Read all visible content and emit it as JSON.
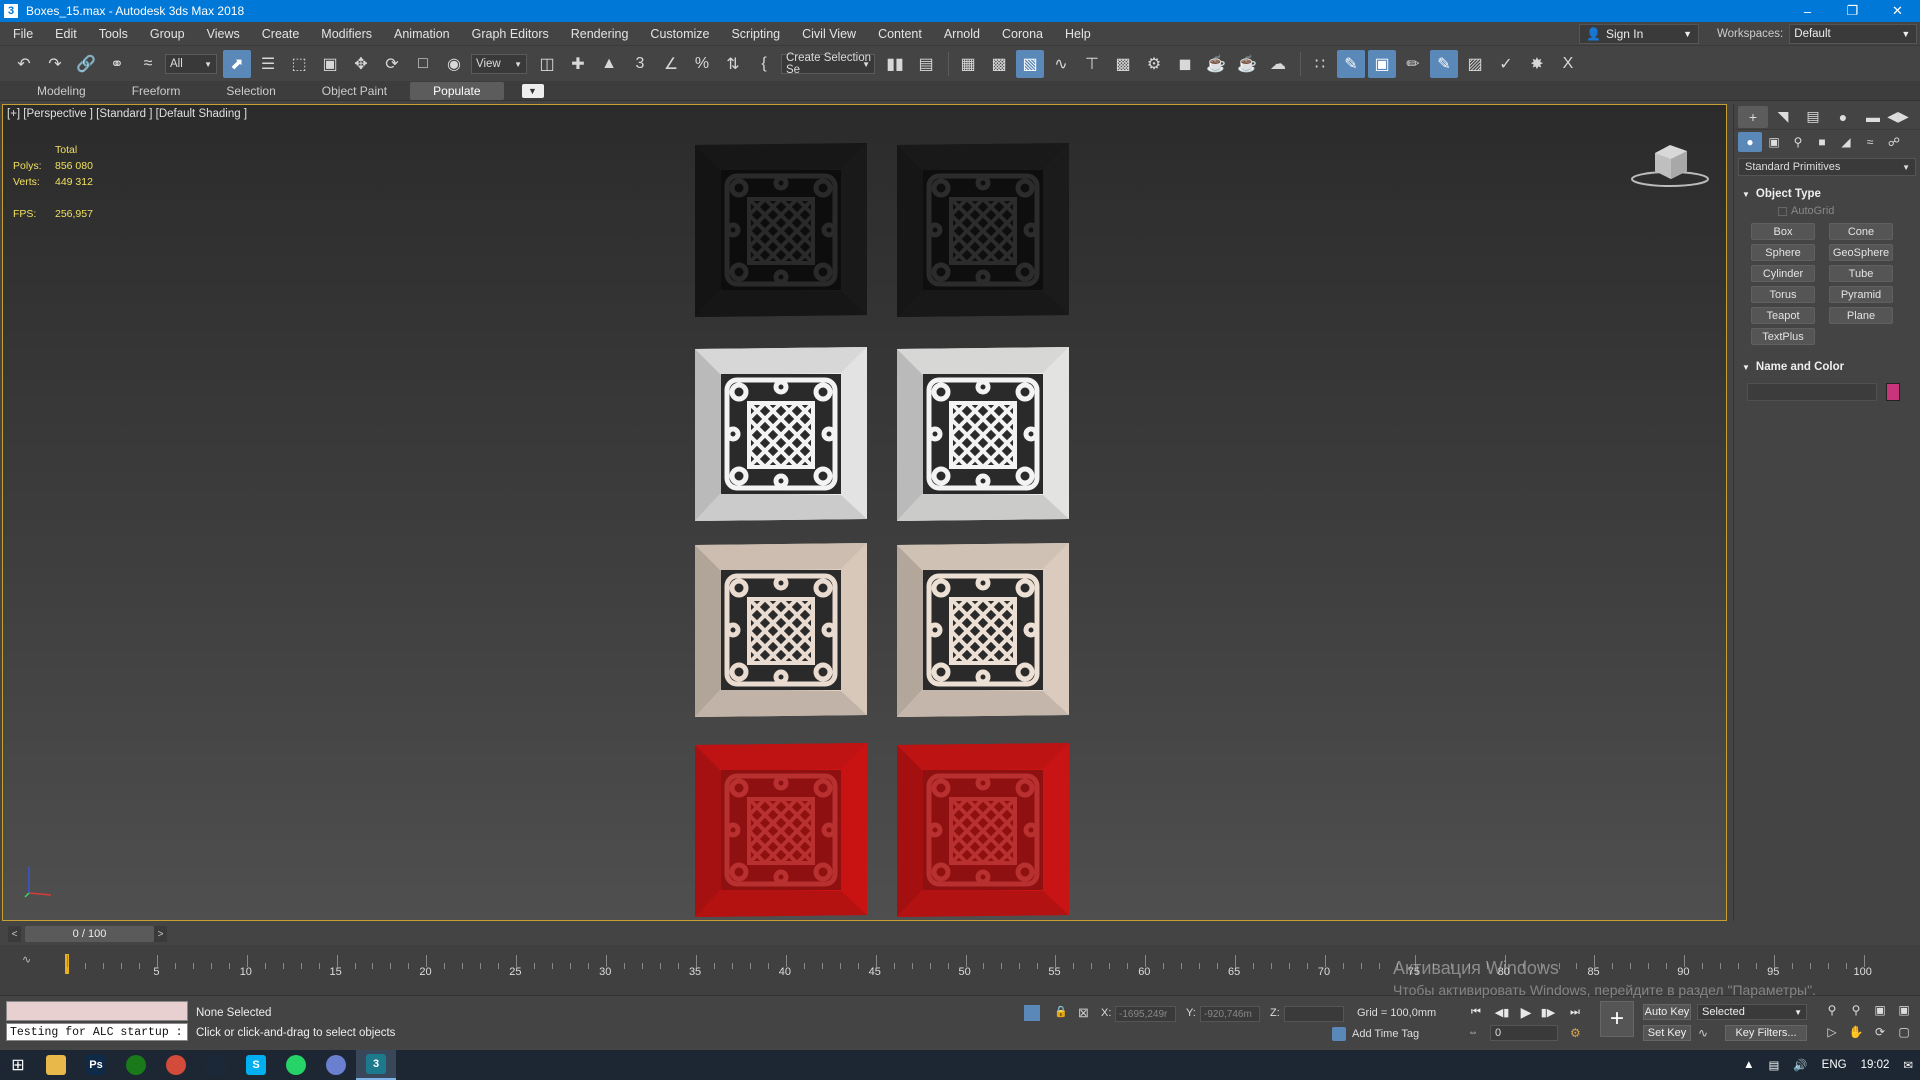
{
  "window": {
    "title": "Boxes_15.max - Autodesk 3ds Max 2018",
    "app_icon": "3"
  },
  "menu": [
    "File",
    "Edit",
    "Tools",
    "Group",
    "Views",
    "Create",
    "Modifiers",
    "Animation",
    "Graph Editors",
    "Rendering",
    "Customize",
    "Scripting",
    "Civil View",
    "Content",
    "Arnold",
    "Corona",
    "Help"
  ],
  "signin": {
    "label": "Sign In"
  },
  "workspaces": {
    "label": "Workspaces:",
    "value": "Default"
  },
  "toolbar": {
    "filter_value": "All",
    "refcoord_value": "View",
    "selection_set_value": "Create Selection Se"
  },
  "ribbon": {
    "tabs": [
      "Modeling",
      "Freeform",
      "Selection",
      "Object Paint",
      "Populate"
    ],
    "active_tab": "Populate"
  },
  "viewport": {
    "label": "[+] [Perspective ] [Standard ] [Default Shading ]",
    "stats": {
      "header": "Total",
      "polys_label": "Polys:",
      "polys_value": "856 080",
      "verts_label": "Verts:",
      "verts_value": "449 312",
      "fps_label": "FPS:",
      "fps_value": "256,957"
    },
    "boxes": [
      {
        "row": 0,
        "col": 0,
        "frame": "#1a1a1a",
        "inner": "#0d0d0d",
        "pattern": "#2a2a2a"
      },
      {
        "row": 0,
        "col": 1,
        "frame": "#1c1c1c",
        "inner": "#0e0e0e",
        "pattern": "#2c2c2c"
      },
      {
        "row": 1,
        "col": 0,
        "frame": "#efefef",
        "inner": "#2a2a2a",
        "pattern": "#f3f3f3"
      },
      {
        "row": 1,
        "col": 1,
        "frame": "#efefee",
        "inner": "#2a2a2a",
        "pattern": "#f3f3f3"
      },
      {
        "row": 2,
        "col": 0,
        "frame": "#e3d2c4",
        "inner": "#2a2a2a",
        "pattern": "#eadbd0"
      },
      {
        "row": 2,
        "col": 1,
        "frame": "#e6d6c8",
        "inner": "#2a2a2a",
        "pattern": "#ecdfd4"
      },
      {
        "row": 3,
        "col": 0,
        "frame": "#d41414",
        "inner": "#8e1010",
        "pattern": "#b83030"
      },
      {
        "row": 3,
        "col": 1,
        "frame": "#d21515",
        "inner": "#8e1010",
        "pattern": "#b83030"
      }
    ],
    "watermark_title": "Активация Windows",
    "watermark_text": "Чтобы активировать Windows, перейдите в раздел \"Параметры\"."
  },
  "command_panel": {
    "category_dropdown": "Standard Primitives",
    "object_type_header": "Object Type",
    "autogrid_label": "AutoGrid",
    "primitives": [
      "Box",
      "Cone",
      "Sphere",
      "GeoSphere",
      "Cylinder",
      "Tube",
      "Torus",
      "Pyramid",
      "Teapot",
      "Plane",
      "TextPlus"
    ],
    "name_color_header": "Name and Color",
    "object_color": "#c8357a"
  },
  "timeslider": {
    "position_label": "0 / 100",
    "left_arrow": "<",
    "right_arrow": ">"
  },
  "trackbar": {
    "ticks": [
      "5",
      "10",
      "15",
      "20",
      "25",
      "30",
      "35",
      "40",
      "45",
      "50",
      "55",
      "60",
      "65",
      "70",
      "75",
      "80",
      "85",
      "90",
      "95",
      "100"
    ]
  },
  "status": {
    "maxscript_output": "Testing for ALC startup :",
    "selection_text": "None Selected",
    "prompt_text": "Click or click-and-drag to select objects",
    "x_label": "X:",
    "x_value": "-1695,249r",
    "y_label": "Y:",
    "y_value": "-920,746m",
    "z_label": "Z:",
    "z_value": "",
    "grid_text": "Grid = 100,0mm",
    "add_time_tag": "Add Time Tag",
    "frame_value": "0",
    "auto_key": "Auto Key",
    "set_key": "Set Key",
    "selected_value": "Selected",
    "key_filters": "Key Filters..."
  },
  "taskbar": {
    "apps": [
      {
        "name": "file-explorer",
        "glyph": "",
        "color": "#e8b84a"
      },
      {
        "name": "photoshop",
        "glyph": "Ps",
        "color": "#0e2a47"
      },
      {
        "name": "xbox-app",
        "glyph": "",
        "color": "#1a7a1a"
      },
      {
        "name": "chrome",
        "glyph": "",
        "color": "#d34b3a"
      },
      {
        "name": "steam",
        "glyph": "",
        "color": "#1b2838"
      },
      {
        "name": "skype",
        "glyph": "S",
        "color": "#00aff0"
      },
      {
        "name": "whatsapp",
        "glyph": "",
        "color": "#25d366"
      },
      {
        "name": "browser",
        "glyph": "",
        "color": "#6a7fd0"
      },
      {
        "name": "3dsmax",
        "glyph": "3",
        "color": "#1d7a8c"
      }
    ],
    "language": "ENG",
    "clock": "19:02"
  }
}
